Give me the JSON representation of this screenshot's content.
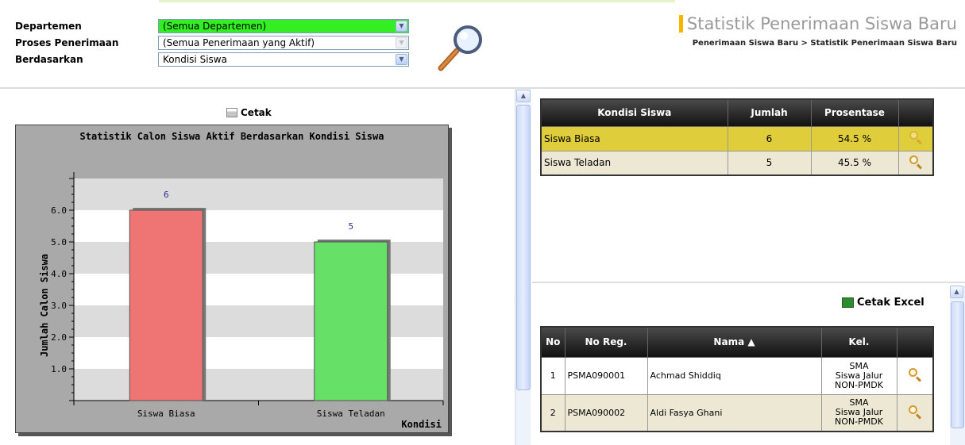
{
  "filters": [
    {
      "label": "Departemen",
      "value": "(Semua Departemen)"
    },
    {
      "label": "Proses Penerimaan",
      "value": "(Semua Penerimaan yang Aktif)"
    },
    {
      "label": "Berdasarkan",
      "value": "Kondisi Siswa"
    }
  ],
  "header": {
    "title": "Statistik Penerimaan Siswa Baru",
    "breadcrumb": "Penerimaan Siswa Baru  >  Statistik Penerimaan Siswa Baru"
  },
  "chart_panel": {
    "print_label": "Cetak"
  },
  "chart_data": {
    "type": "bar",
    "title": "Statistik Calon Siswa Aktif Berdasarkan Kondisi Siswa",
    "xlabel": "Kondisi",
    "ylabel": "Jumlah Calon Siswa",
    "categories": [
      "Siswa Biasa",
      "Siswa Teladan"
    ],
    "values": [
      6,
      5
    ],
    "data_labels": [
      "6",
      "5"
    ],
    "yticks": [
      "1.0",
      "2.0",
      "3.0",
      "4.0",
      "5.0",
      "6.0"
    ],
    "ylim": [
      0,
      7
    ],
    "bar_colors": [
      "#ef7474",
      "#66e066"
    ],
    "grid": "alternating horizontal bands"
  },
  "summary_table": {
    "headers": [
      "Kondisi Siswa",
      "Jumlah",
      "Prosentase",
      ""
    ],
    "rows": [
      {
        "kondisi": "Siswa Biasa",
        "jumlah": "6",
        "prosentase": "54.5 %"
      },
      {
        "kondisi": "Siswa Teladan",
        "jumlah": "5",
        "prosentase": "45.5 %"
      }
    ]
  },
  "detail_panel": {
    "excel_label": "Cetak Excel"
  },
  "detail_table": {
    "headers": [
      "No",
      "No Reg.",
      "Nama ▲",
      "Kel.",
      ""
    ],
    "rows": [
      {
        "no": "1",
        "noreg": "PSMA090001",
        "nama": "Achmad Shiddiq",
        "kel1": "SMA",
        "kel2": "Siswa Jalur",
        "kel3": "NON-PMDK"
      },
      {
        "no": "2",
        "noreg": "PSMA090002",
        "nama": "Aldi Fasya Ghani",
        "kel1": "SMA",
        "kel2": "Siswa Jalur",
        "kel3": "NON-PMDK"
      }
    ]
  },
  "colors": {
    "accent": "#f7b500",
    "selected_filter": "#33ee22",
    "highlight_row": "#e0cd3c"
  }
}
